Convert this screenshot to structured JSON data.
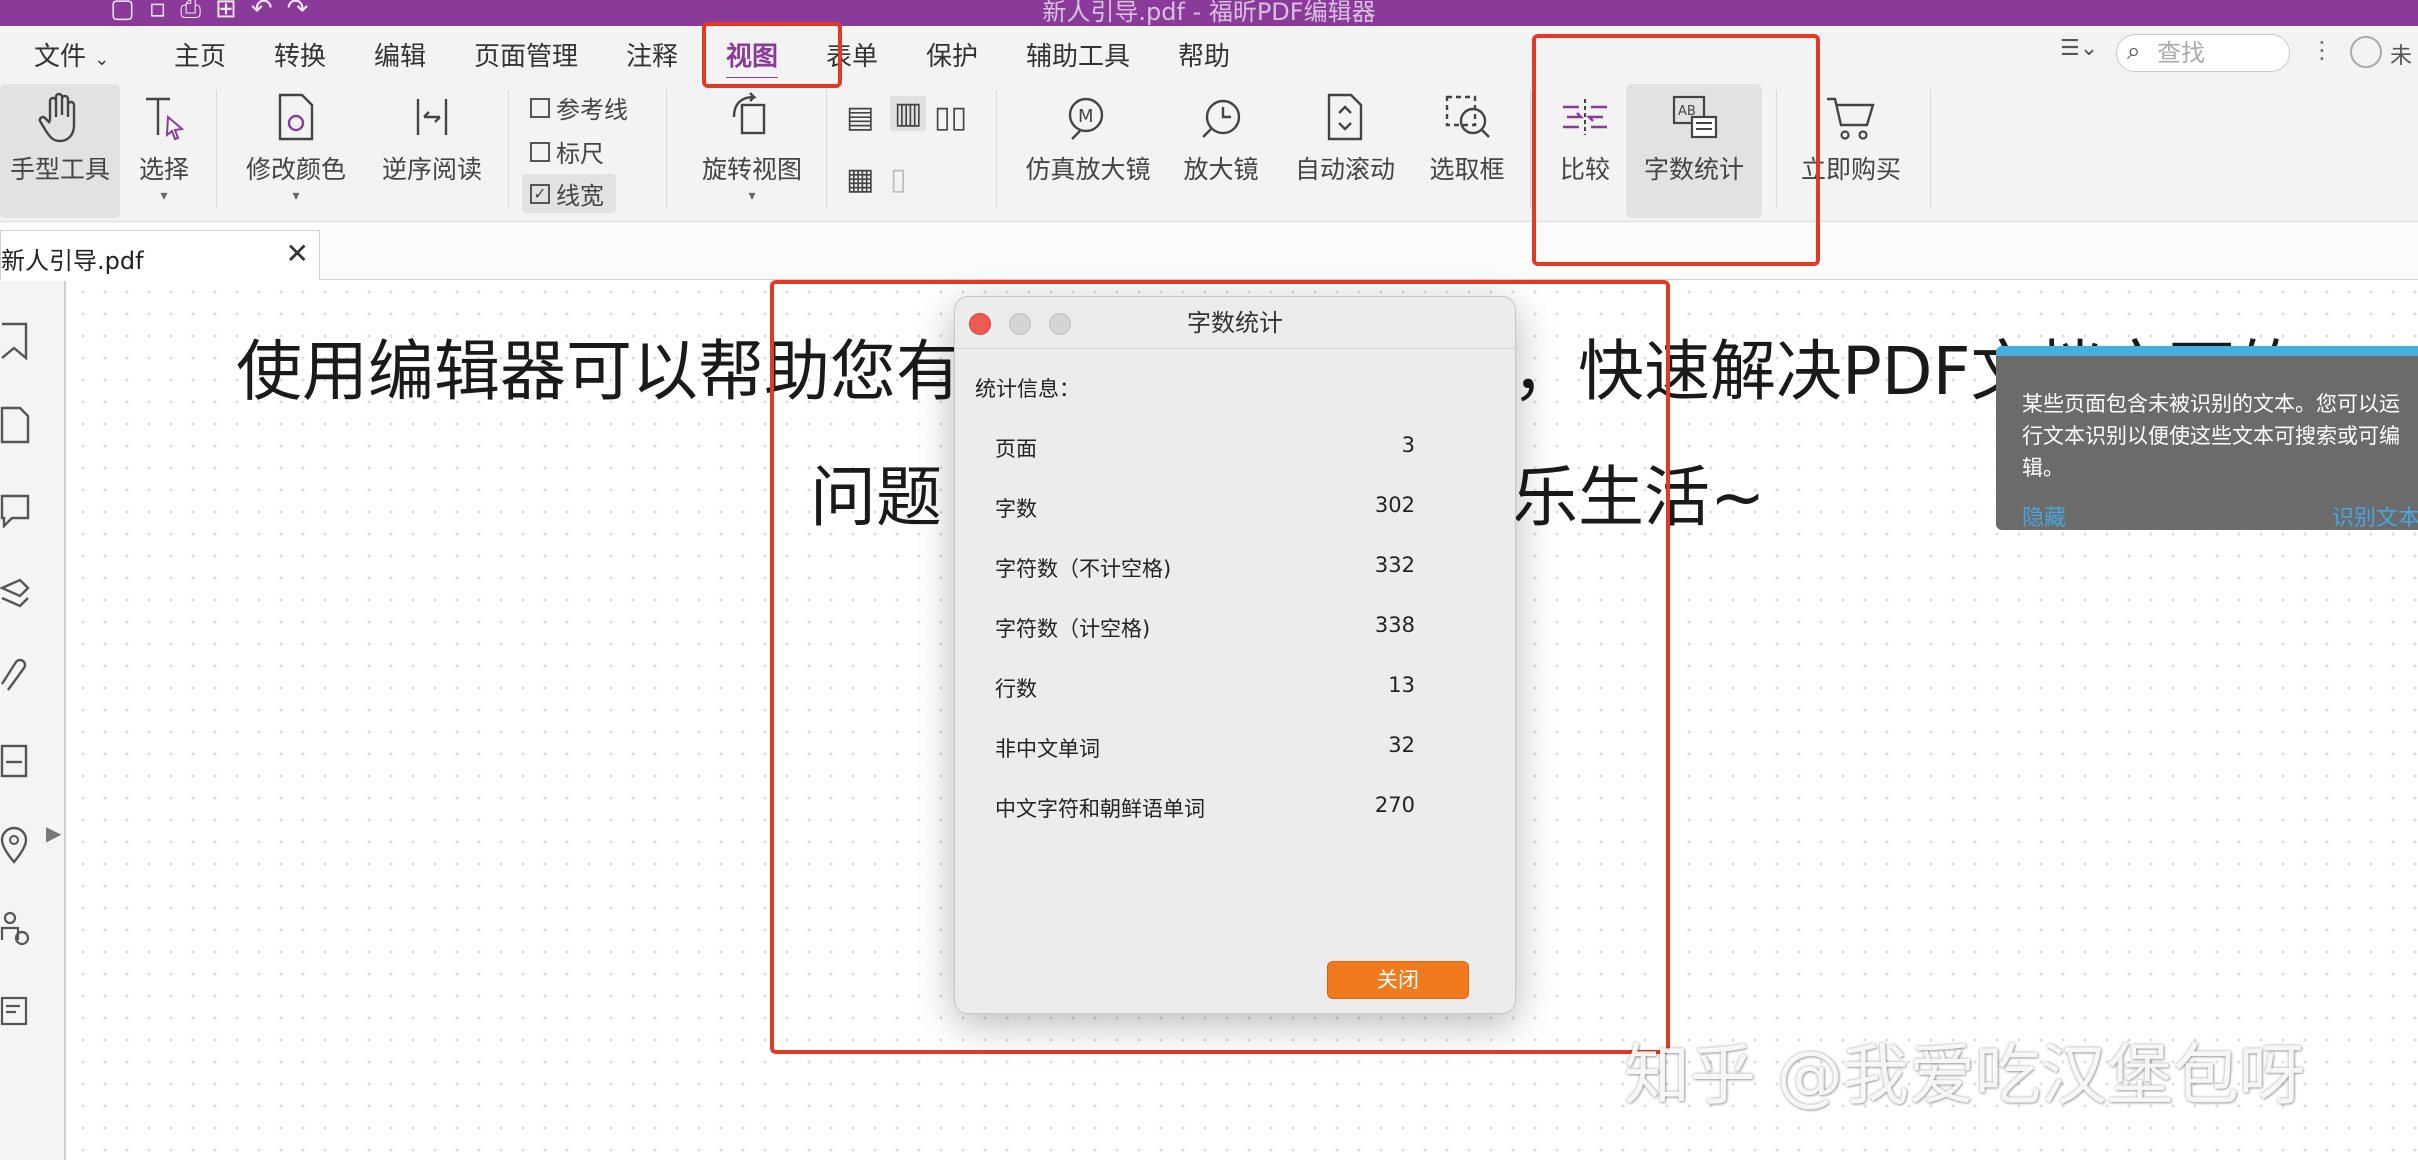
{
  "app": {
    "window_title": "新人引导.pdf - 福昕PDF编辑器",
    "quick_access": [
      "▢",
      "▫",
      "⎙",
      "⊞",
      "↶",
      "↷"
    ]
  },
  "menu": {
    "file": "文件",
    "items": [
      "主页",
      "转换",
      "编辑",
      "页面管理",
      "注释",
      "视图",
      "表单",
      "保护",
      "辅助工具",
      "帮助"
    ],
    "active": "视图",
    "search_placeholder": "查找",
    "user_label": "未"
  },
  "ribbon": {
    "hand_tool": "手型工具",
    "select": "选择",
    "modify_color": "修改颜色",
    "reverse_read": "逆序阅读",
    "guides": "参考线",
    "ruler": "标尺",
    "linewidth": "线宽",
    "linewidth_checked": true,
    "rotate_view": "旋转视图",
    "true_magnifier": "仿真放大镜",
    "magnifier": "放大镜",
    "auto_scroll": "自动滚动",
    "marquee": "选取框",
    "compare": "比较",
    "word_count": "字数统计",
    "buy_now": "立即购买"
  },
  "tab": {
    "filename": "新人引导.pdf",
    "close": "✕"
  },
  "document": {
    "line1_a": "使用编辑器可以帮助您有",
    "line1_b": "，快速解决PDF文档方面的",
    "line2_a": "问题",
    "line2_b": "乐生活~"
  },
  "notice": {
    "message": "某些页面包含未被识别的文本。您可以运行文本识别以便使这些文本可搜索或可编辑。",
    "hide": "隐藏",
    "recognize": "识别文本"
  },
  "dialog": {
    "title": "字数统计",
    "heading": "统计信息：",
    "rows": [
      {
        "label": "页面",
        "value": "3"
      },
      {
        "label": "字数",
        "value": "302"
      },
      {
        "label": "字符数（不计空格)",
        "value": "332"
      },
      {
        "label": "字符数（计空格)",
        "value": "338"
      },
      {
        "label": "行数",
        "value": "13"
      },
      {
        "label": "非中文单词",
        "value": "32"
      },
      {
        "label": "中文字符和朝鲜语单词",
        "value": "270"
      }
    ],
    "close_button": "关闭"
  },
  "watermark": "知乎 @我爱吃汉堡包呀",
  "colors": {
    "brand": "#8a3a98",
    "annotation_red": "#e03a26",
    "close_button": "#f07a1d",
    "notice_bg": "#6b6b6b",
    "notice_accent": "#47aede"
  }
}
